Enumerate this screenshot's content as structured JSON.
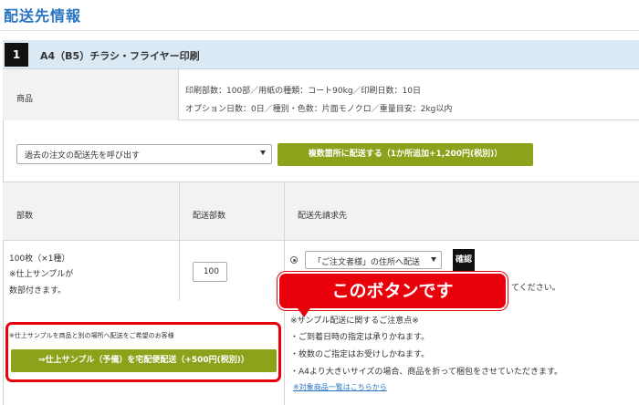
{
  "page": {
    "title": "配送先情報"
  },
  "product": {
    "number": "1",
    "title": "A4（B5）チラシ・フライヤー印刷",
    "spec_label": "商品",
    "spec_line1": "印刷部数：100部／用紙の種類：コート90kg／印刷日数：10日",
    "spec_line2": "オプション日数：0日／種別・色数：片面モノクロ／重量目安：2kg以内"
  },
  "controls": {
    "past_address_select": "過去の注文の配送先を呼び出す",
    "multi_ship_button": "複数箇所に配送する（1か所追加+1,200円(税別)）"
  },
  "table": {
    "headers": [
      "部数",
      "配送部数",
      "配送先請求先"
    ],
    "qty_line1": "100枚（×1種）",
    "qty_line2": "※仕上サンプルが",
    "qty_line3": "数部付きます。",
    "ship_qty": "100",
    "address_select": "「ご注文者様」の住所へ配送",
    "confirm_button": "確認",
    "partial_text": "てください。"
  },
  "sample": {
    "note": "※仕上サンプルを商品と別の場所へ配送をご希望のお客様",
    "button": "⇒仕上サンプル（予備）を宅配便配送（+500円(税別)）"
  },
  "notice": {
    "heading": "※サンプル配送に関するご注意点※",
    "items": [
      "・ご到着日時の指定は承りかねます。",
      "・枚数のご指定はお受けしかねます。",
      "・A4より大きいサイズの場合、商品を折って梱包をさせていただきます。"
    ],
    "link": "※対象商品一覧はこちらから"
  },
  "callout": {
    "text": "このボタンです"
  },
  "colors": {
    "accent_green": "#8da11a",
    "callout_red": "#e8000a",
    "title_blue": "#2a75c2",
    "header_blue": "#dbe9f5"
  }
}
